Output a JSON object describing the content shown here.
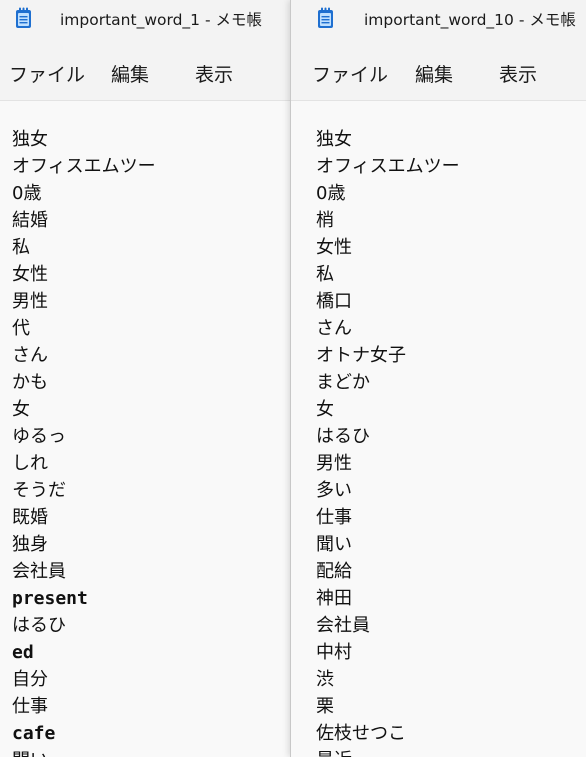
{
  "left_window": {
    "title": "important_word_1 - メモ帳",
    "menu": [
      "ファイル",
      "編集",
      "表示"
    ],
    "lines": [
      {
        "text": "独女",
        "mono": false
      },
      {
        "text": "オフィスエムツー",
        "mono": false
      },
      {
        "text": "0歳",
        "mono": false
      },
      {
        "text": "結婚",
        "mono": false
      },
      {
        "text": "私",
        "mono": false
      },
      {
        "text": "女性",
        "mono": false
      },
      {
        "text": "男性",
        "mono": false
      },
      {
        "text": "代",
        "mono": false
      },
      {
        "text": "さん",
        "mono": false
      },
      {
        "text": "かも",
        "mono": false
      },
      {
        "text": "女",
        "mono": false
      },
      {
        "text": "ゆるっ",
        "mono": false
      },
      {
        "text": "しれ",
        "mono": false
      },
      {
        "text": "そうだ",
        "mono": false
      },
      {
        "text": "既婚",
        "mono": false
      },
      {
        "text": "独身",
        "mono": false
      },
      {
        "text": "会社員",
        "mono": false
      },
      {
        "text": "present",
        "mono": true
      },
      {
        "text": "はるひ",
        "mono": false
      },
      {
        "text": "ed",
        "mono": true
      },
      {
        "text": "自分",
        "mono": false
      },
      {
        "text": "仕事",
        "mono": false
      },
      {
        "text": "cafe",
        "mono": true
      },
      {
        "text": "聞い",
        "mono": false
      }
    ]
  },
  "right_window": {
    "title": "important_word_10 - メモ帳",
    "menu": [
      "ファイル",
      "編集",
      "表示"
    ],
    "lines": [
      {
        "text": "独女",
        "mono": false
      },
      {
        "text": "オフィスエムツー",
        "mono": false
      },
      {
        "text": "0歳",
        "mono": false
      },
      {
        "text": "梢",
        "mono": false
      },
      {
        "text": "女性",
        "mono": false
      },
      {
        "text": "私",
        "mono": false
      },
      {
        "text": "橋口",
        "mono": false
      },
      {
        "text": "さん",
        "mono": false
      },
      {
        "text": "オトナ女子",
        "mono": false
      },
      {
        "text": "まどか",
        "mono": false
      },
      {
        "text": "女",
        "mono": false
      },
      {
        "text": "はるひ",
        "mono": false
      },
      {
        "text": "男性",
        "mono": false
      },
      {
        "text": "多い",
        "mono": false
      },
      {
        "text": "仕事",
        "mono": false
      },
      {
        "text": "聞い",
        "mono": false
      },
      {
        "text": "配給",
        "mono": false
      },
      {
        "text": "神田",
        "mono": false
      },
      {
        "text": "会社員",
        "mono": false
      },
      {
        "text": "中村",
        "mono": false
      },
      {
        "text": "渋",
        "mono": false
      },
      {
        "text": "栗",
        "mono": false
      },
      {
        "text": "佐枝せつこ",
        "mono": false
      },
      {
        "text": "最近",
        "mono": false
      }
    ]
  },
  "icon": "notepad-icon",
  "colors": {
    "icon_blue": "#1e6fd0",
    "icon_light": "#bfe0ff",
    "background": "#f9f9f9",
    "chrome": "#f3f3f3"
  }
}
